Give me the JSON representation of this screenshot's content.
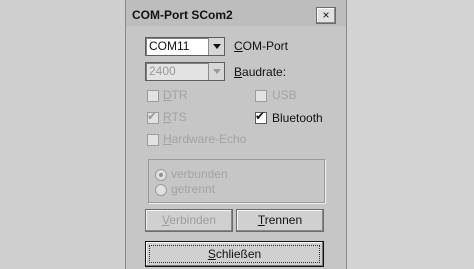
{
  "window": {
    "title": "COM-Port SCom2",
    "close_label": "×"
  },
  "port": {
    "value": "COM11",
    "label_accel": "C",
    "label_rest": "OM-Port"
  },
  "baud": {
    "value": "2400",
    "label_accel": "B",
    "label_rest": "audrate:"
  },
  "checks": {
    "dtr": {
      "accel": "D",
      "rest": "TR",
      "checked": false,
      "enabled": false
    },
    "rts": {
      "accel": "R",
      "rest": "TS",
      "checked": true,
      "enabled": false
    },
    "hw_echo": {
      "accel": "H",
      "rest": "ardware-Echo",
      "checked": false,
      "enabled": false
    },
    "usb": {
      "label": "USB",
      "checked": false,
      "enabled": false
    },
    "bluetooth": {
      "label": "Bluetooth",
      "checked": true,
      "enabled": true
    },
    "check_mark": "✔"
  },
  "status": {
    "connected_label": "verbunden",
    "disconnected_label": "getrennt",
    "selected": "verbunden"
  },
  "buttons": {
    "connect": {
      "accel": "V",
      "rest": "erbinden",
      "enabled": false
    },
    "disconnect": {
      "accel": "T",
      "rest": "rennen",
      "enabled": true
    },
    "close": {
      "accel": "S",
      "rest": "chließen",
      "enabled": true
    }
  }
}
